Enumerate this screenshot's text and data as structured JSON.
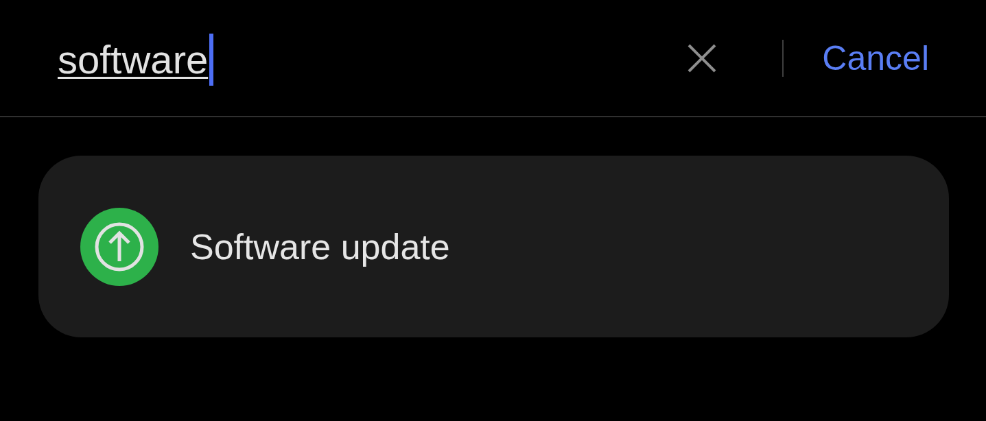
{
  "search_bar": {
    "query": "software",
    "composing": true,
    "focused": true,
    "cancel_label": "Cancel"
  },
  "results": [
    {
      "title": "Software update"
    }
  ]
}
